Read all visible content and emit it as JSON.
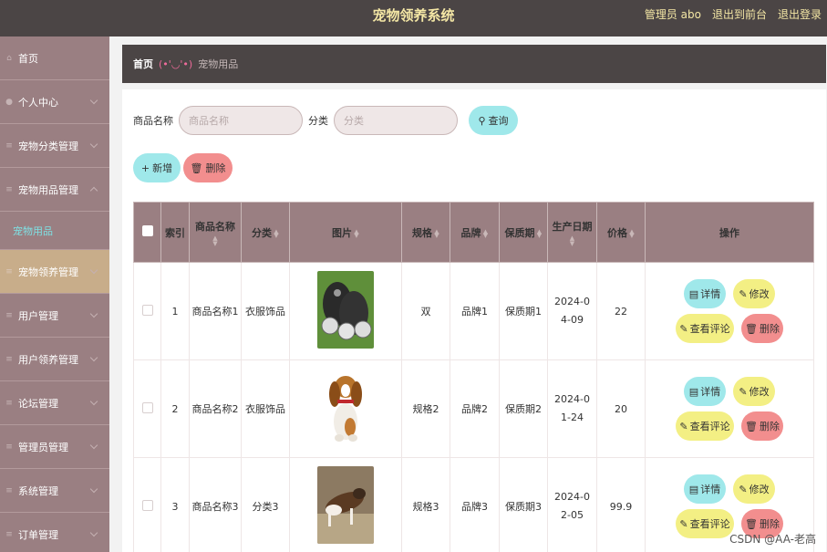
{
  "header": {
    "title": "宠物领养系统",
    "admin": "管理员 abo",
    "back_front": "退出到前台",
    "logout": "退出登录"
  },
  "sidebar": {
    "items": [
      {
        "label": "首页",
        "icon": "home-icon"
      },
      {
        "label": "个人中心",
        "icon": "user-icon"
      },
      {
        "label": "宠物分类管理",
        "icon": "menu-icon"
      },
      {
        "label": "宠物用品管理",
        "icon": "menu-icon"
      },
      {
        "label": "宠物领养管理",
        "icon": "menu-icon"
      },
      {
        "label": "用户管理",
        "icon": "menu-icon"
      },
      {
        "label": "用户领养管理",
        "icon": "menu-icon"
      },
      {
        "label": "论坛管理",
        "icon": "menu-icon"
      },
      {
        "label": "管理员管理",
        "icon": "menu-icon"
      },
      {
        "label": "系统管理",
        "icon": "menu-icon"
      },
      {
        "label": "订单管理",
        "icon": "menu-icon"
      }
    ],
    "sub_item": "宠物用品"
  },
  "breadcrumb": {
    "home": "首页",
    "face": "(•'◡'•)",
    "current": "宠物用品"
  },
  "search": {
    "name_label": "商品名称",
    "name_placeholder": "商品名称",
    "category_label": "分类",
    "category_placeholder": "分类",
    "query_btn": "查询"
  },
  "actions": {
    "add": "新增",
    "delete": "删除"
  },
  "table": {
    "headers": [
      "索引",
      "商品名称",
      "分类",
      "图片",
      "规格",
      "品牌",
      "保质期",
      "生产日期",
      "价格",
      "操作"
    ],
    "rows": [
      {
        "index": "1",
        "name": "商品名称1",
        "category": "衣服饰品",
        "spec": "双",
        "brand": "品牌1",
        "shelf": "保质期1",
        "date": "2024-04-09",
        "price": "22"
      },
      {
        "index": "2",
        "name": "商品名称2",
        "category": "衣服饰品",
        "spec": "规格2",
        "brand": "品牌2",
        "shelf": "保质期2",
        "date": "2024-01-24",
        "price": "20"
      },
      {
        "index": "3",
        "name": "商品名称3",
        "category": "分类3",
        "spec": "规格3",
        "brand": "品牌3",
        "shelf": "保质期3",
        "date": "2024-02-05",
        "price": "99.9"
      }
    ],
    "row_buttons": {
      "detail": "详情",
      "edit": "修改",
      "comment": "查看评论",
      "delete": "删除"
    }
  },
  "watermark": "CSDN @AA-老高",
  "colors": {
    "topbar": "#4b4545",
    "sidebar": "#9a7f82",
    "accent_cyan": "#9fe8ea",
    "accent_yellow": "#f3ef84",
    "accent_red": "#f28e8e",
    "title": "#f4e7a5"
  }
}
